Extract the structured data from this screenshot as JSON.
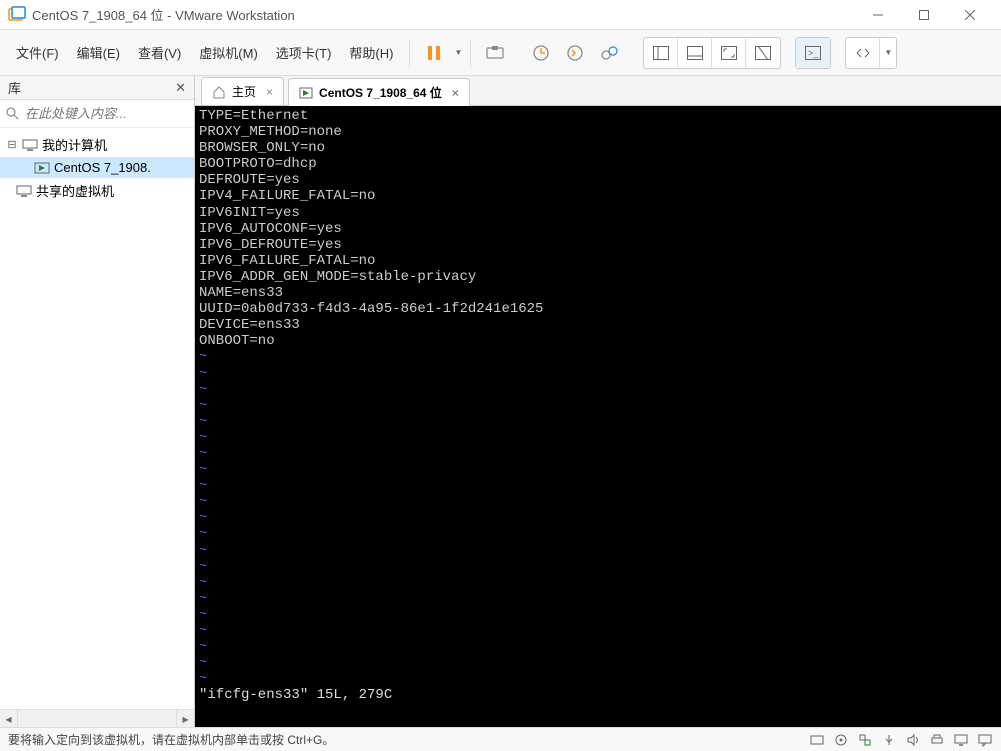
{
  "titlebar": {
    "title": "CentOS 7_1908_64 位 - VMware Workstation"
  },
  "menu": {
    "file": "文件(F)",
    "edit": "编辑(E)",
    "view": "查看(V)",
    "vm": "虚拟机(M)",
    "tabs": "选项卡(T)",
    "help": "帮助(H)"
  },
  "sidebar": {
    "panel_title": "库",
    "search_placeholder": "在此处键入内容...",
    "nodes": {
      "root": "我的计算机",
      "vm1": "CentOS 7_1908.",
      "shared": "共享的虚拟机"
    }
  },
  "tabs": {
    "home": "主页",
    "vm": "CentOS 7_1908_64 位"
  },
  "terminal": {
    "lines": [
      "TYPE=Ethernet",
      "PROXY_METHOD=none",
      "BROWSER_ONLY=no",
      "BOOTPROTO=dhcp",
      "DEFROUTE=yes",
      "IPV4_FAILURE_FATAL=no",
      "IPV6INIT=yes",
      "IPV6_AUTOCONF=yes",
      "IPV6_DEFROUTE=yes",
      "IPV6_FAILURE_FATAL=no",
      "IPV6_ADDR_GEN_MODE=stable-privacy",
      "NAME=ens33",
      "UUID=0ab0d733-f4d3-4a95-86e1-1f2d241e1625",
      "DEVICE=ens33",
      "ONBOOT=no"
    ],
    "status": "\"ifcfg-ens33\" 15L, 279C"
  },
  "footer": {
    "hint": "要将输入定向到该虚拟机，请在虚拟机内部单击或按 Ctrl+G。"
  }
}
